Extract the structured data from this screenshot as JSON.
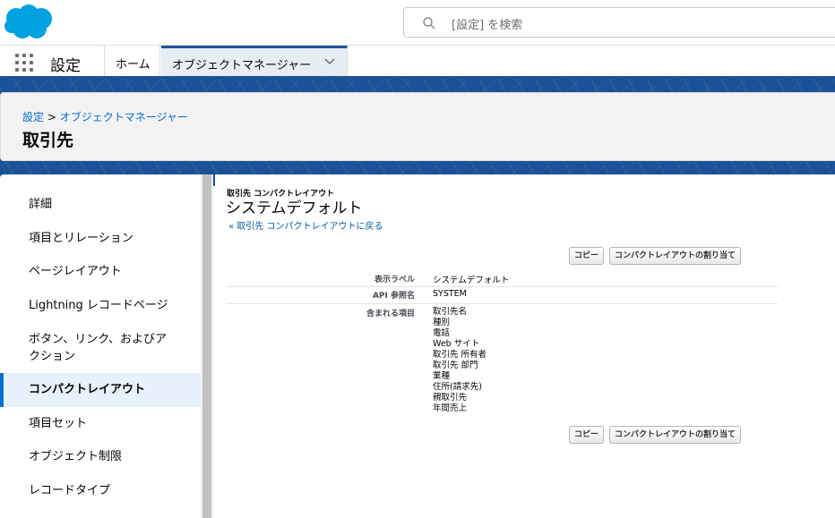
{
  "header": {
    "search_placeholder": "[設定] を検索"
  },
  "nav": {
    "app_name": "設定",
    "tabs": [
      {
        "label": "ホーム"
      },
      {
        "label": "オブジェクトマネージャー"
      }
    ]
  },
  "page_header": {
    "breadcrumb_root": "設定",
    "breadcrumb_sep": ">",
    "breadcrumb_current": "オブジェクトマネージャー",
    "title": "取引先"
  },
  "sidebar": {
    "items": [
      {
        "label": "詳細"
      },
      {
        "label": "項目とリレーション"
      },
      {
        "label": "ページレイアウト"
      },
      {
        "label": "Lightning レコードページ"
      },
      {
        "label": "ボタン、リンク、およびア"
      },
      {
        "label": "クション"
      },
      {
        "label": "コンパクトレイアウト"
      },
      {
        "label": "項目セット"
      },
      {
        "label": "オブジェクト制限"
      },
      {
        "label": "レコードタイプ"
      }
    ]
  },
  "main": {
    "section_label": "取引先 コンパクトレイアウト",
    "layout_name": "システムデフォルト",
    "back_link": "« 取引先 コンパクトレイアウトに戻る",
    "copy_button": "コピー",
    "assign_button": "コンパクトレイアウトの割り当て",
    "fields": {
      "display_label_name": "表示ラベル",
      "display_label_value": "システムデフォルト",
      "api_name_label": "API 参照名",
      "api_name_value": "SYSTEM",
      "included_label": "含まれる項目",
      "included_items": [
        "取引先名",
        "種別",
        "電話",
        "Web サイト",
        "取引先 所有者",
        "取引先 部門",
        "業種",
        "住所(請求先)",
        "親取引先",
        "年間売上"
      ]
    }
  }
}
